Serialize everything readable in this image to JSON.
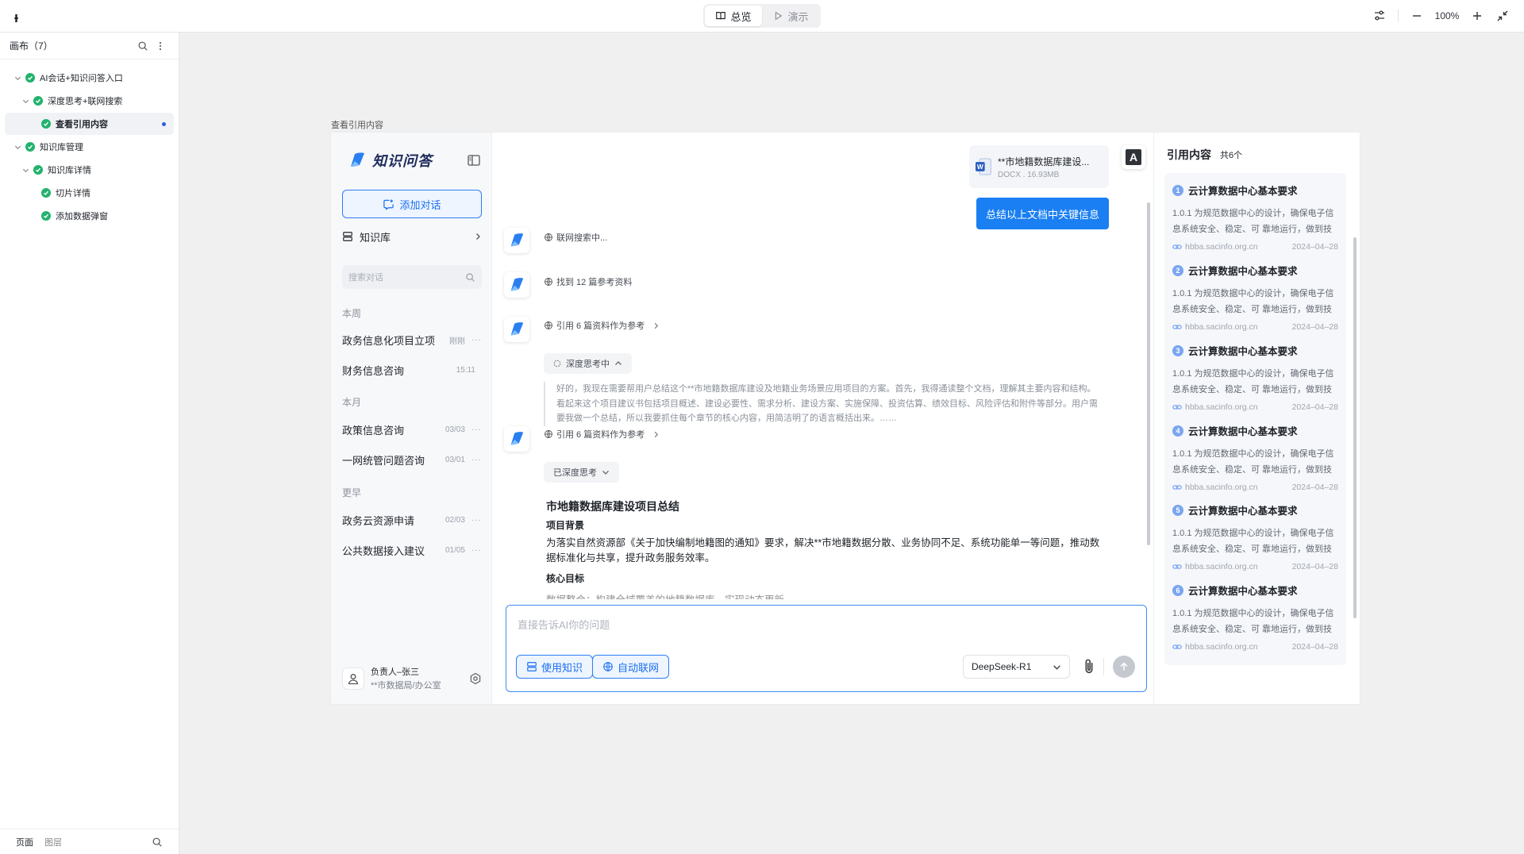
{
  "topbar": {
    "logo": "ᵻ",
    "seg_overview": "总览",
    "seg_present": "演示",
    "zoom": "100%"
  },
  "layers": {
    "title": "画布（7）",
    "nodes": [
      {
        "label": "AI会话+知识问答入口",
        "level": 0,
        "expanded": true
      },
      {
        "label": "深度思考+联网搜索",
        "level": 1,
        "expanded": true
      },
      {
        "label": "查看引用内容",
        "level": 2,
        "selected": true
      },
      {
        "label": "知识库管理",
        "level": 0,
        "expanded": true
      },
      {
        "label": "知识库详情",
        "level": 1,
        "expanded": true
      },
      {
        "label": "切片详情",
        "level": 2
      },
      {
        "label": "添加数据弹窗",
        "level": 2
      }
    ],
    "footer_tab_pages": "页面",
    "footer_tab_layers": "图层"
  },
  "frame_label": "查看引用内容",
  "sidebar": {
    "brand": "知识问答",
    "add_chat": "添加对话",
    "knowledge_base": "知识库",
    "search_placeholder": "搜索对话",
    "groups": {
      "this_week": "本周",
      "this_month": "本月",
      "earlier": "更早"
    },
    "conversations": [
      {
        "title": "政务信息化项目立项",
        "date": "刚刚",
        "more": "···"
      },
      {
        "title": "财务信息咨询",
        "date": "15:11",
        "more": ""
      },
      {
        "title": "政策信息咨询",
        "date": "03/03",
        "more": "···"
      },
      {
        "title": "一网统管问题咨询",
        "date": "03/01",
        "more": "···"
      },
      {
        "title": "政务云资源申请",
        "date": "02/03",
        "more": "···"
      },
      {
        "title": "公共数据接入建议",
        "date": "01/05",
        "more": "···"
      }
    ],
    "user": {
      "name": "负责人–张三",
      "org": "**市数据局/办公室"
    }
  },
  "chat": {
    "file": {
      "name": "**市地籍数据库建设...",
      "meta": "DOCX . 16.93MB"
    },
    "user_message": "总结以上文档中关键信息",
    "steps": {
      "searching": "联网搜索中...",
      "found": "找到 12 篇参考资料",
      "cite1": "引用 6 篇资料作为参考",
      "thinking": "深度思考中",
      "cite2": "引用 6 篇资料作为参考",
      "thought": "已深度思考"
    },
    "think_text": "好的，我现在需要帮用户总结这个**市地籍数据库建设及地籍业务场景应用项目的方案。首先，我得通读整个文档，理解其主要内容和结构。看起来这个项目建议书包括项目概述、建设必要性、需求分析、建设方案、实施保障、投资估算、绩效目标、风险评估和附件等部分。用户需要我做一个总结，所以我要抓住每个章节的核心内容，用简洁明了的语言概括出来。……",
    "answer_title": "市地籍数据库建设项目总结",
    "h_background": "项目背景",
    "p_background": "为落实自然资源部《关于加快编制地籍图的通知》要求，解决**市地籍数据分散、业务协同不足、系统功能单一等问题，推动数据标准化与共享，提升政务服务效率。",
    "h_goal": "核心目标",
    "p_goal_cut": "数据整合：构建全域覆盖的地籍数据库，实现动态更新",
    "composer_placeholder": "直接告诉AI你的问题",
    "btn_knowledge": "使用知识",
    "btn_web": "自动联网",
    "model": "DeepSeek-R1"
  },
  "citations": {
    "title": "引用内容",
    "count": "共6个",
    "cards": [
      {
        "num": "1",
        "title": "云计算数据中心基本要求",
        "body": "1.0.1 为规范数据中心的设计，确保电子信息系统安全、稳定、可 靠地运行，做到技术先进",
        "source": "hbba.sacinfo.org.cn",
        "date": "2024–04–28"
      },
      {
        "num": "2",
        "title": "云计算数据中心基本要求",
        "body": "1.0.1 为规范数据中心的设计，确保电子信息系统安全、稳定、可 靠地运行，做到技术先进",
        "source": "hbba.sacinfo.org.cn",
        "date": "2024–04–28"
      },
      {
        "num": "3",
        "title": "云计算数据中心基本要求",
        "body": "1.0.1 为规范数据中心的设计，确保电子信息系统安全、稳定、可 靠地运行，做到技术先进",
        "source": "hbba.sacinfo.org.cn",
        "date": "2024–04–28"
      },
      {
        "num": "4",
        "title": "云计算数据中心基本要求",
        "body": "1.0.1 为规范数据中心的设计，确保电子信息系统安全、稳定、可 靠地运行，做到技术先进",
        "source": "hbba.sacinfo.org.cn",
        "date": "2024–04–28"
      },
      {
        "num": "5",
        "title": "云计算数据中心基本要求",
        "body": "1.0.1 为规范数据中心的设计，确保电子信息系统安全、稳定、可 靠地运行，做到技术先进",
        "source": "hbba.sacinfo.org.cn",
        "date": "2024–04–28"
      },
      {
        "num": "6",
        "title": "云计算数据中心基本要求",
        "body": "1.0.1 为规范数据中心的设计，确保电子信息系统安全、稳定、可 靠地运行，做到技术先进",
        "source": "hbba.sacinfo.org.cn",
        "date": "2024–04–28"
      }
    ]
  }
}
